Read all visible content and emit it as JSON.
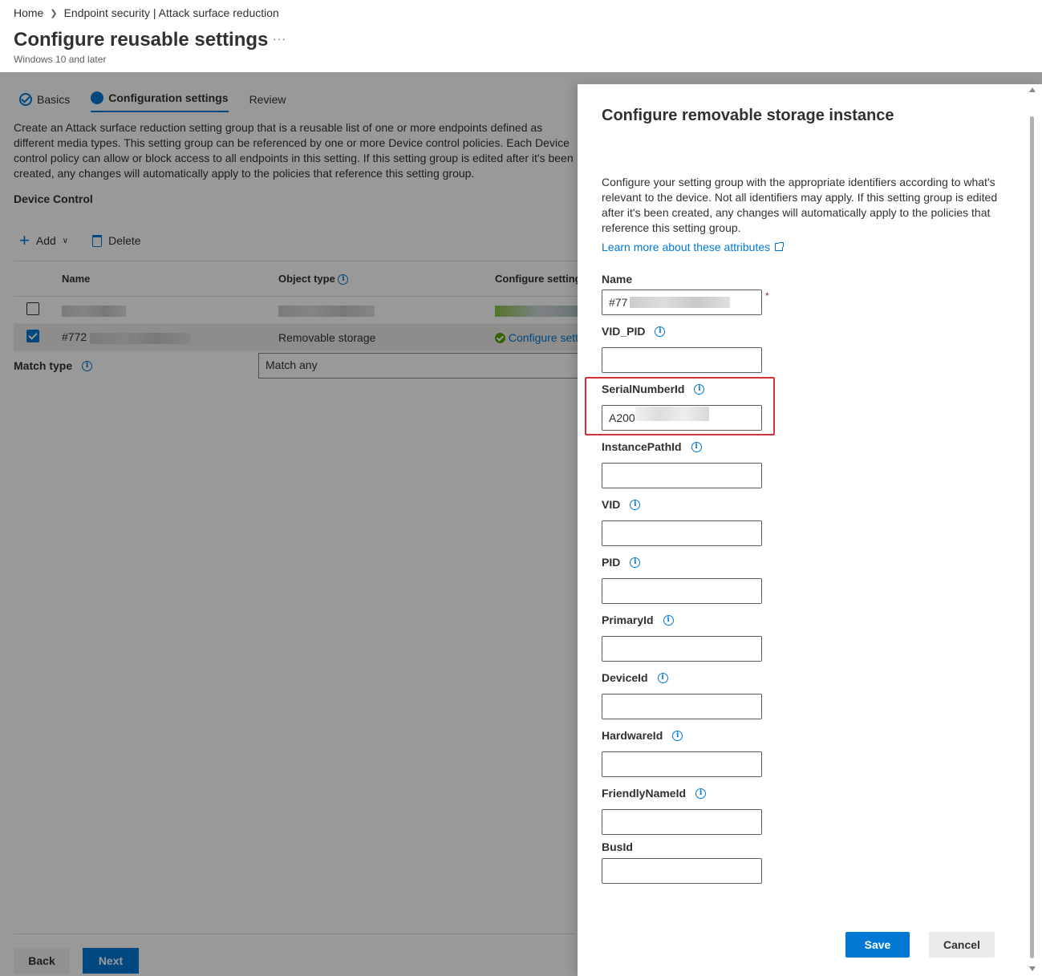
{
  "breadcrumb": {
    "home": "Home",
    "section": "Endpoint security | Attack surface reduction"
  },
  "page": {
    "title": "Configure reusable settings",
    "subtitle": "Windows 10 and later",
    "more": "···"
  },
  "steps": [
    {
      "label": "Basics",
      "state": "done"
    },
    {
      "label": "Configuration settings",
      "state": "current"
    },
    {
      "label": "Review",
      "state": "pending"
    }
  ],
  "description": "Create an Attack surface reduction setting group that is a reusable list of one or more endpoints defined as different media types. This setting group can be referenced by one or more Device control policies. Each Device control policy can allow or block access to all endpoints in this setting. If this setting group is edited after it's been created, any changes will automatically apply to the policies that reference this setting group.",
  "device_control": {
    "title": "Device Control"
  },
  "toolbar": {
    "add": "Add",
    "delete": "Delete"
  },
  "table": {
    "headers": {
      "name": "Name",
      "object_type": "Object type",
      "configure": "Configure settings"
    },
    "rows": [
      {
        "name": "",
        "type": "",
        "configure": "",
        "selected": false
      },
      {
        "name": "#772",
        "type": "Removable storage",
        "configure": "Configure settings",
        "selected": true
      }
    ]
  },
  "match": {
    "label": "Match type",
    "value": "Match any"
  },
  "footer": {
    "back": "Back",
    "next": "Next"
  },
  "panel": {
    "title": "Configure removable storage instance",
    "description": "Configure your setting group with the appropriate identifiers according to what's relevant to the device. Not all identifiers may apply. If this setting group is edited after it's been created, any changes will automatically apply to the policies that reference this setting group.",
    "learn_more": "Learn more about these attributes",
    "required_mark": "*",
    "fields": {
      "name": {
        "label": "Name",
        "value": "#77"
      },
      "vid_pid": {
        "label": "VID_PID",
        "value": ""
      },
      "serial": {
        "label": "SerialNumberId",
        "value": "A200"
      },
      "instance": {
        "label": "InstancePathId",
        "value": ""
      },
      "vid": {
        "label": "VID",
        "value": ""
      },
      "pid": {
        "label": "PID",
        "value": ""
      },
      "primary": {
        "label": "PrimaryId",
        "value": ""
      },
      "device": {
        "label": "DeviceId",
        "value": ""
      },
      "hardware": {
        "label": "HardwareId",
        "value": ""
      },
      "friendly": {
        "label": "FriendlyNameId",
        "value": ""
      },
      "bus": {
        "label": "BusId",
        "value": ""
      }
    },
    "save": "Save",
    "cancel": "Cancel"
  },
  "colors": {
    "accent": "#0078d4",
    "highlight": "#d13438",
    "success": "#57a300"
  }
}
